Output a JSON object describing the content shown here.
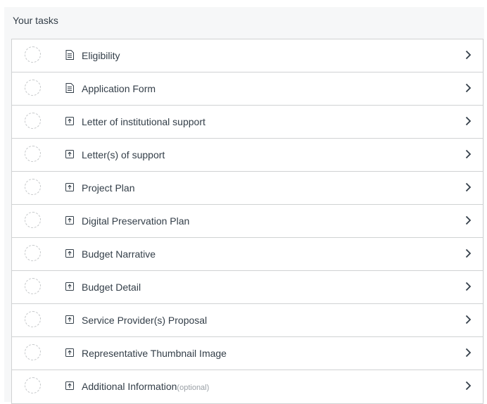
{
  "heading": "Your tasks",
  "colors": {
    "text": "#333e48",
    "panel_bg": "#f6f7f8",
    "border": "#d0d2d3",
    "status_ring": "#c4c7c9",
    "optional_text": "#9aa0a6"
  },
  "tasks": [
    {
      "label": "Eligibility",
      "icon": "document-icon",
      "status": "not-started"
    },
    {
      "label": "Application Form",
      "icon": "document-icon",
      "status": "not-started"
    },
    {
      "label": "Letter of institutional support",
      "icon": "upload-icon",
      "status": "not-started"
    },
    {
      "label": "Letter(s) of support",
      "icon": "upload-icon",
      "status": "not-started"
    },
    {
      "label": "Project Plan",
      "icon": "upload-icon",
      "status": "not-started"
    },
    {
      "label": "Digital Preservation Plan",
      "icon": "upload-icon",
      "status": "not-started"
    },
    {
      "label": "Budget Narrative",
      "icon": "upload-icon",
      "status": "not-started"
    },
    {
      "label": "Budget Detail",
      "icon": "upload-icon",
      "status": "not-started"
    },
    {
      "label": "Service Provider(s) Proposal",
      "icon": "upload-icon",
      "status": "not-started"
    },
    {
      "label": "Representative Thumbnail Image",
      "icon": "upload-icon",
      "status": "not-started"
    },
    {
      "label": "Additional Information",
      "optional_tag": "(optional)",
      "icon": "upload-icon",
      "status": "not-started"
    }
  ]
}
